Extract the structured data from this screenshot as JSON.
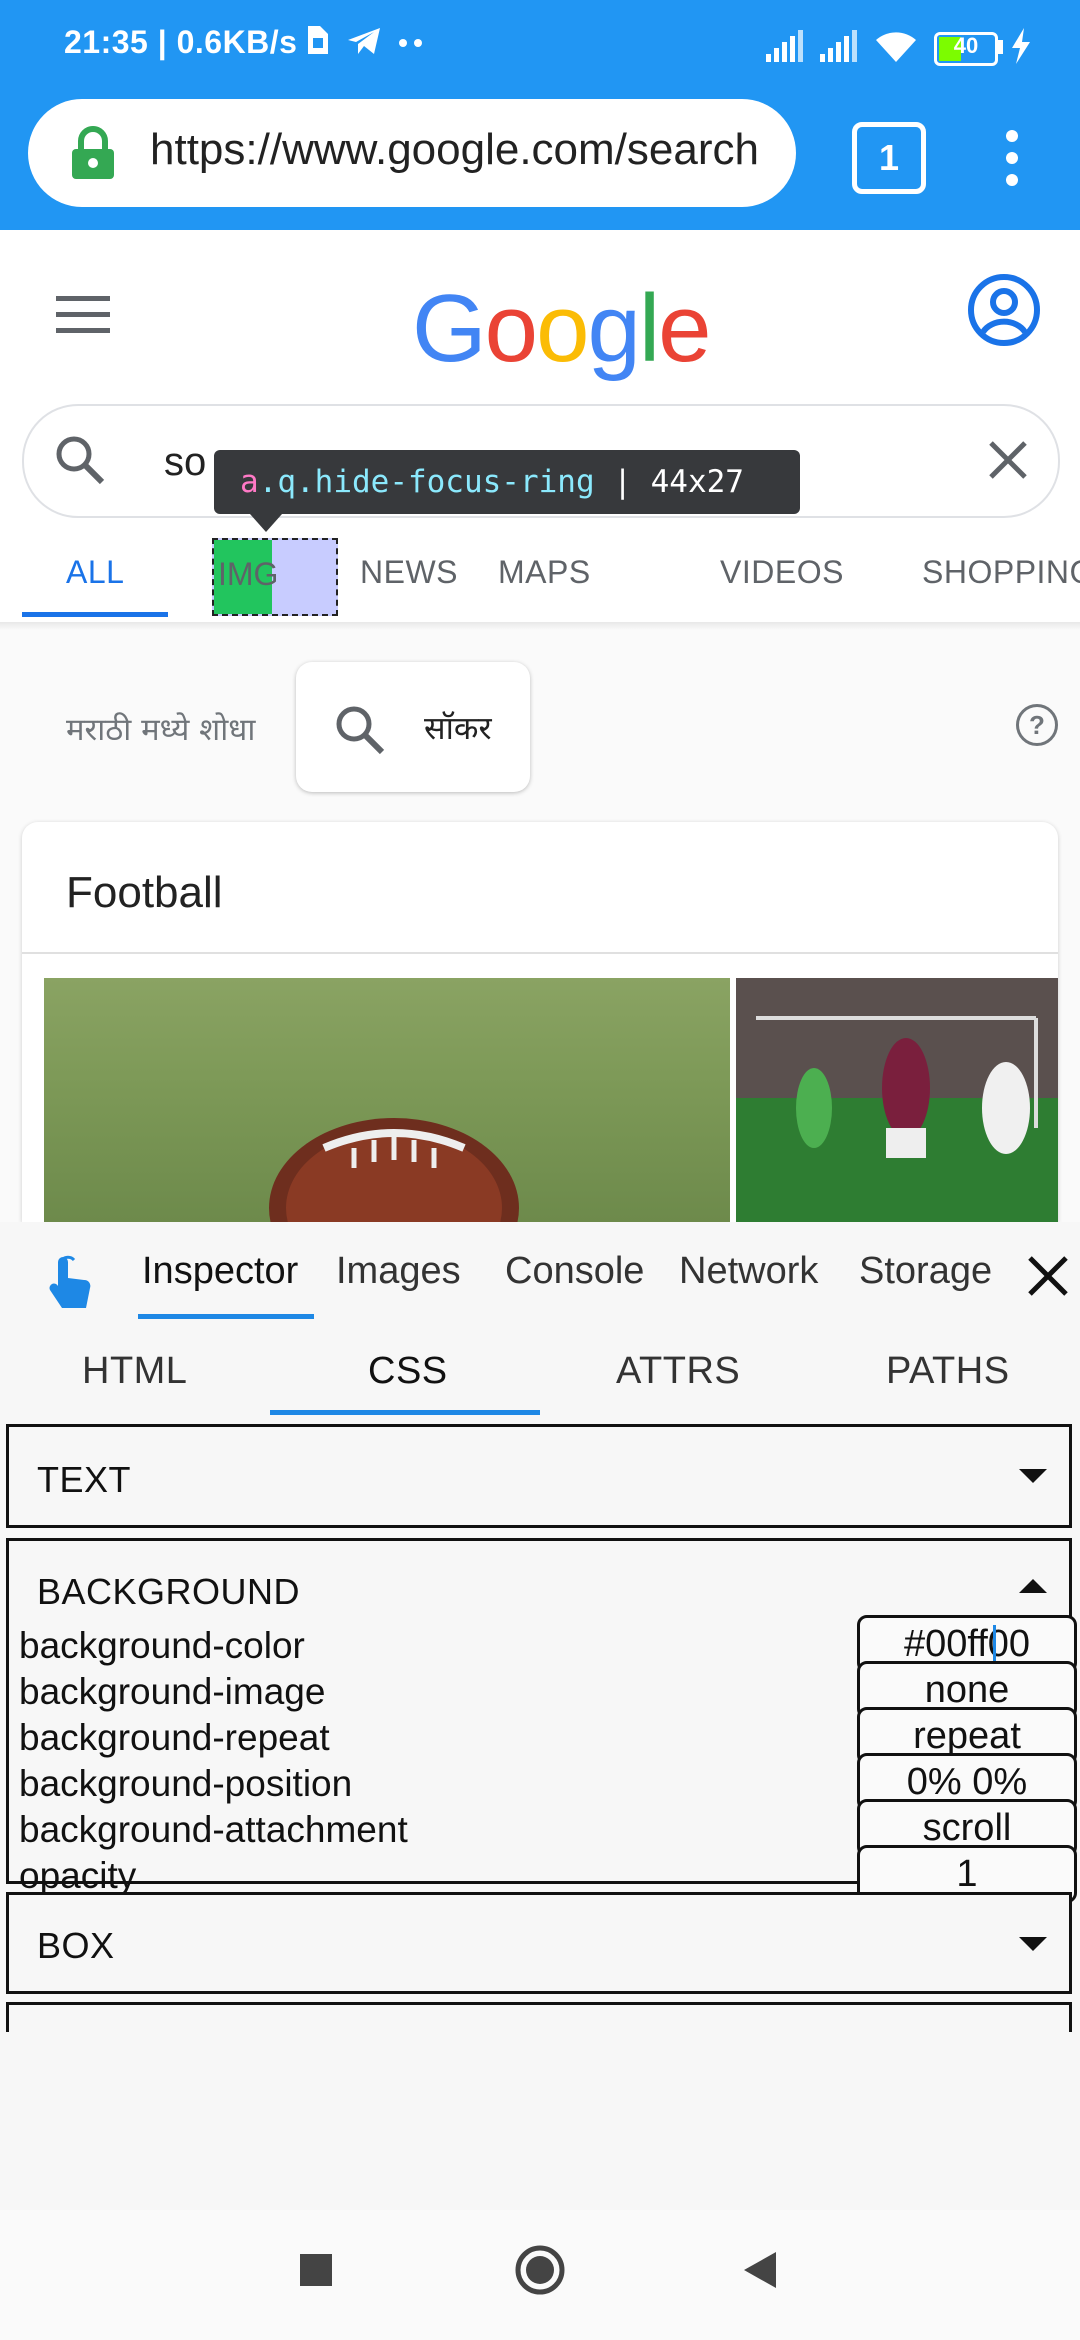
{
  "status_bar": {
    "time_speed": "21:35 | 0.6KB/s",
    "battery": "40"
  },
  "browser": {
    "url": "https://www.google.com/search",
    "tab_count": "1"
  },
  "google": {
    "search_query": "so",
    "tabs": [
      "ALL",
      "NEWS",
      "MAPS",
      "VIDEOS",
      "SHOPPING"
    ],
    "active_tab": "ALL",
    "lang_label": "मराठी मध्ये शोधा",
    "lang_chip": "सॉकर",
    "help_glyph": "?",
    "card_title": "Football"
  },
  "inspector_overlay": {
    "selector_tag": "a",
    "selector_classes": ".q.hide-focus-ring",
    "separator": " | ",
    "size": "44x27",
    "highlight_text": "IMG"
  },
  "devtools": {
    "tabs": [
      "Inspector",
      "Images",
      "Console",
      "Network",
      "Storage"
    ],
    "active_tab": "Inspector",
    "subtabs": [
      "HTML",
      "CSS",
      "ATTRS",
      "PATHS"
    ],
    "active_subtab": "CSS",
    "sections": {
      "text": "TEXT",
      "background": "BACKGROUND",
      "box": "BOX"
    },
    "background_props": [
      {
        "name": "background-color",
        "value": "#00ff00"
      },
      {
        "name": "background-image",
        "value": "none"
      },
      {
        "name": "background-repeat",
        "value": "repeat"
      },
      {
        "name": "background-position",
        "value": "0% 0%"
      },
      {
        "name": "background-attachment",
        "value": "scroll"
      },
      {
        "name": "opacity",
        "value": "1"
      }
    ]
  },
  "colors": {
    "browser_blue": "#2196f3",
    "google_blue": "#4285f4",
    "google_red": "#ea4335",
    "google_yellow": "#fbbc05",
    "google_green": "#34a853",
    "active_tab_blue": "#1a73e8",
    "highlight_green": "#22c55e",
    "highlight_padding": "#c8ccff"
  },
  "icons": {
    "status": [
      "sim-card-icon",
      "telegram-icon",
      "more-dots-icon",
      "signal-icon",
      "wifi-icon",
      "battery-icon",
      "charging-icon"
    ],
    "browser": [
      "lock-icon",
      "tabs-icon",
      "overflow-menu-icon"
    ],
    "google": [
      "hamburger-menu-icon",
      "account-icon",
      "search-icon",
      "clear-icon",
      "help-icon"
    ],
    "devtools": [
      "touch-select-icon",
      "close-icon"
    ],
    "nav": [
      "recents-icon",
      "home-icon",
      "back-icon"
    ]
  }
}
